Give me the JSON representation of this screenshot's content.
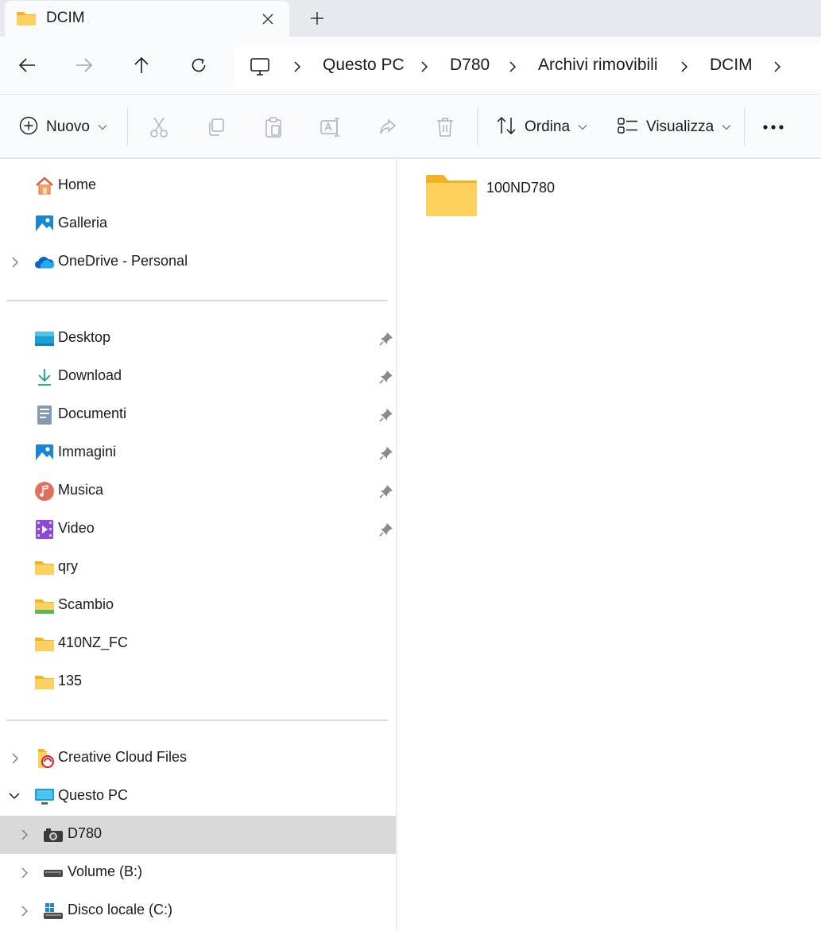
{
  "window": {
    "tab_title": "DCIM",
    "tab_icon": "folder-icon",
    "close_tab_icon": "close-icon",
    "new_tab_icon": "plus-icon"
  },
  "navigation": {
    "back_icon": "arrow-left-icon",
    "forward_icon": "arrow-right-icon",
    "up_icon": "arrow-up-icon",
    "refresh_icon": "refresh-icon",
    "breadcrumb": [
      "Questo PC",
      "D780",
      "Archivi rimovibili",
      "DCIM"
    ]
  },
  "toolbar": {
    "new_label": "Nuovo",
    "sort_label": "Ordina",
    "view_label": "Visualizza",
    "icons": [
      "cut-icon",
      "copy-icon",
      "paste-icon",
      "rename-icon",
      "share-icon",
      "delete-icon",
      "more-icon"
    ]
  },
  "sidebar": {
    "top": [
      {
        "label": "Home",
        "icon": "home-icon"
      },
      {
        "label": "Galleria",
        "icon": "gallery-icon"
      },
      {
        "label": "OneDrive - Personal",
        "icon": "cloud-icon"
      }
    ],
    "quick_access": [
      {
        "label": "Desktop",
        "icon": "desktop-icon",
        "pinned": true
      },
      {
        "label": "Download",
        "icon": "download-icon",
        "pinned": true
      },
      {
        "label": "Documenti",
        "icon": "documents-icon",
        "pinned": true
      },
      {
        "label": "Immagini",
        "icon": "pictures-icon",
        "pinned": true
      },
      {
        "label": "Musica",
        "icon": "music-icon",
        "pinned": true
      },
      {
        "label": "Video",
        "icon": "video-icon",
        "pinned": true
      },
      {
        "label": "qry",
        "icon": "folder-icon",
        "pinned": false
      },
      {
        "label": "Scambio",
        "icon": "shared-folder-icon",
        "pinned": false
      },
      {
        "label": "410NZ_FC",
        "icon": "folder-icon",
        "pinned": false
      },
      {
        "label": "135",
        "icon": "folder-icon",
        "pinned": false
      }
    ],
    "devices": [
      {
        "label": "Creative Cloud Files",
        "icon": "creative-cloud-icon",
        "expanded": false
      },
      {
        "label": "Questo PC",
        "icon": "pc-icon",
        "expanded": true
      },
      {
        "label": "D780",
        "icon": "camera-icon",
        "selected": true
      },
      {
        "label": "Volume (B:)",
        "icon": "drive-icon"
      },
      {
        "label": "Disco locale (C:)",
        "icon": "windows-drive-icon"
      }
    ]
  },
  "content": {
    "items": [
      {
        "name": "100ND780",
        "icon": "folder-icon"
      }
    ]
  },
  "colors": {
    "folder_yellow": "#f8c93c",
    "accent_blue": "#0067c0",
    "selected_row": "#d9d9d9"
  }
}
